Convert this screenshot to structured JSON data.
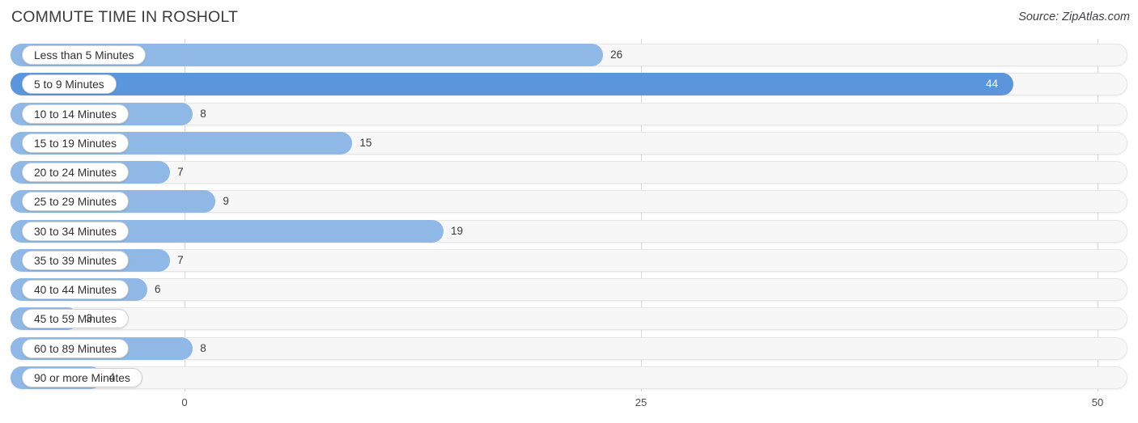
{
  "header": {
    "title": "COMMUTE TIME IN ROSHOLT",
    "source": "Source: ZipAtlas.com"
  },
  "colors": {
    "bar_default": "#8fb8e6",
    "bar_highlight": "#5b96dd",
    "track": "#f7f7f7",
    "track_border": "#e6e6e6",
    "gridline": "#d8d8d8",
    "label_text": "#303030",
    "value_text": "#3a3a3a",
    "value_text_inside": "#ffffff"
  },
  "chart_data": {
    "type": "bar",
    "orientation": "horizontal",
    "title": "COMMUTE TIME IN ROSHOLT",
    "xlabel": "",
    "ylabel": "",
    "xlim": [
      0,
      50
    ],
    "grid": true,
    "legend": null,
    "xticks": [
      "0",
      "25",
      "50"
    ],
    "xtick_values": [
      0,
      25,
      50
    ],
    "categories": [
      "Less than 5 Minutes",
      "5 to 9 Minutes",
      "10 to 14 Minutes",
      "15 to 19 Minutes",
      "20 to 24 Minutes",
      "25 to 29 Minutes",
      "30 to 34 Minutes",
      "35 to 39 Minutes",
      "40 to 44 Minutes",
      "45 to 59 Minutes",
      "60 to 89 Minutes",
      "90 or more Minutes"
    ],
    "values": [
      26,
      44,
      8,
      15,
      7,
      9,
      19,
      7,
      6,
      3,
      8,
      4
    ],
    "value_labels": [
      "26",
      "44",
      "8",
      "15",
      "7",
      "9",
      "19",
      "7",
      "6",
      "3",
      "8",
      "4"
    ],
    "highlight_index": 1
  }
}
